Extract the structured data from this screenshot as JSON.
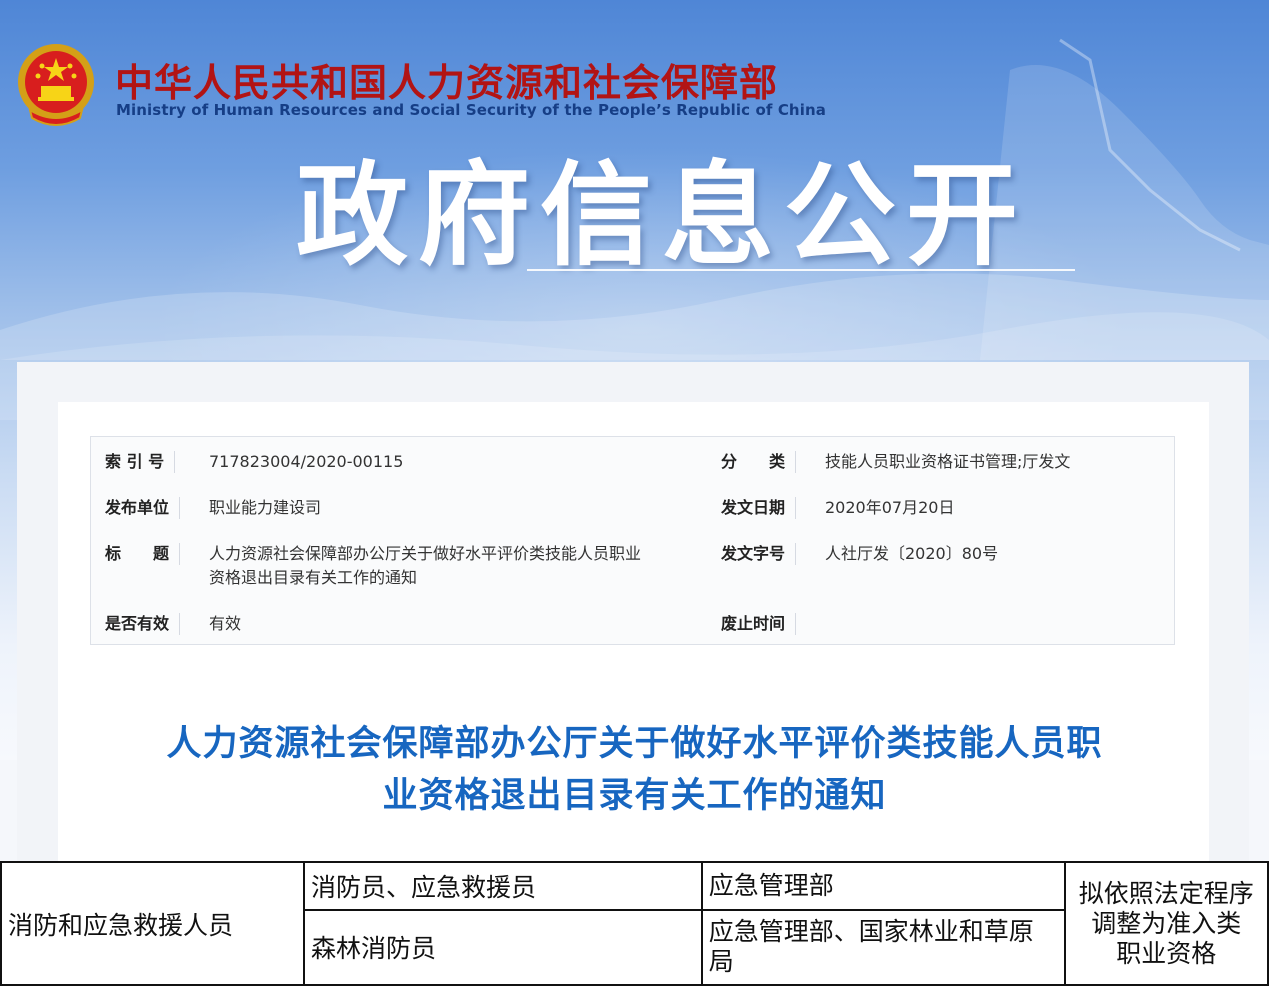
{
  "header": {
    "org_name_cn": "中华人民共和国人力资源和社会保障部",
    "org_name_en": "Ministry of Human Resources and Social Security of the People’s Republic of China",
    "banner_title": "政府信息公开",
    "emblem_icon": "national-emblem-icon"
  },
  "meta": {
    "index_label": "索 引 号",
    "index_value": "717823004/2020-00115",
    "category_label": "分　　类",
    "category_value": "技能人员职业资格证书管理;厅发文",
    "publisher_label": "发布单位",
    "publisher_value": "职业能力建设司",
    "date_label": "发文日期",
    "date_value": "2020年07月20日",
    "title_label": "标　　题",
    "title_value_line1": "人力资源社会保障部办公厅关于做好水平评价类技能人员职业",
    "title_value_line2": "资格退出目录有关工作的通知",
    "docno_label": "发文字号",
    "docno_value": "人社厅发〔2020〕80号",
    "valid_label": "是否有效",
    "valid_value": "有效",
    "expire_label": "废止时间",
    "expire_value": ""
  },
  "article": {
    "title_line1": "人力资源社会保障部办公厅关于做好水平评价类技能人员职",
    "title_line2": "业资格退出目录有关工作的通知"
  },
  "table": {
    "category": "消防和应急救援人员",
    "rows": [
      {
        "occupation": "消防员、应急救援员",
        "department": "应急管理部"
      },
      {
        "occupation": "森林消防员",
        "department_line1": "应急管理部、国家林业和草原",
        "department_line2": "局"
      }
    ],
    "note_line1": "拟依照法定程序",
    "note_line2": "调整为准入类",
    "note_line3": "职业资格"
  },
  "colors": {
    "banner_blue": "#4f86d6",
    "org_red": "#b21414",
    "title_blue": "#1766c0"
  }
}
